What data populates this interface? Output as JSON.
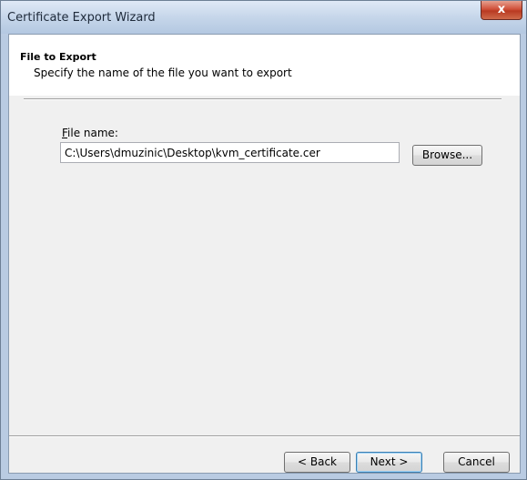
{
  "window": {
    "title": "Certificate Export Wizard",
    "close_label": "x"
  },
  "header": {
    "title": "File to Export",
    "subtitle": "Specify the name of the file you want to export"
  },
  "form": {
    "file_label_accel": "F",
    "file_label_rest": "ile name:",
    "file_value": "C:\\Users\\dmuzinic\\Desktop\\kvm_certificate.cer",
    "browse_label": "Browse..."
  },
  "footer": {
    "back_label": "< Back",
    "next_label": "Next >",
    "cancel_label": "Cancel"
  }
}
